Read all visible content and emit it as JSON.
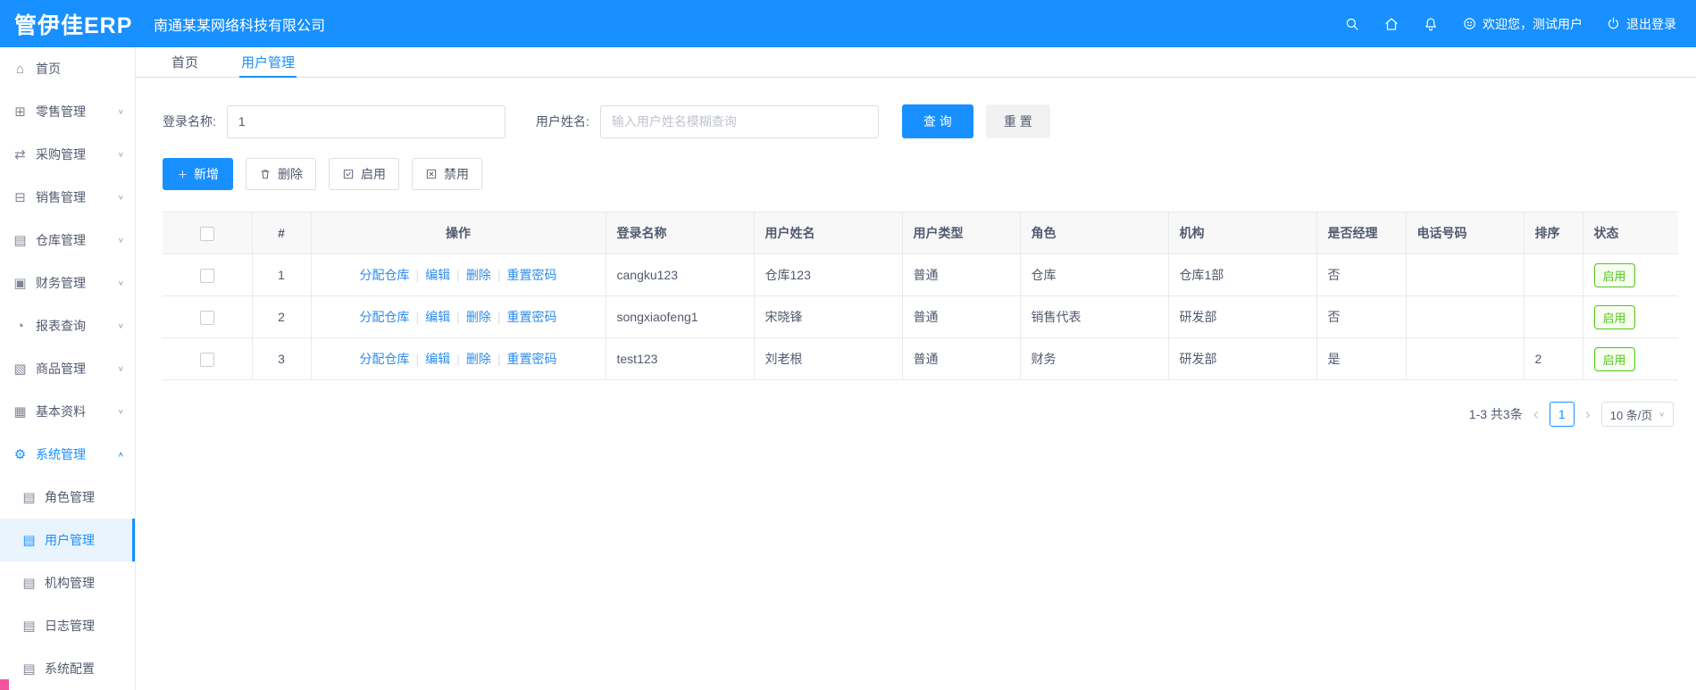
{
  "topbar": {
    "logo": "管伊佳ERP",
    "company": "南通某某网络科技有限公司",
    "welcome": "欢迎您，测试用户",
    "logout": "退出登录"
  },
  "sidebar": {
    "items": [
      {
        "label": "首页"
      },
      {
        "label": "零售管理"
      },
      {
        "label": "采购管理"
      },
      {
        "label": "销售管理"
      },
      {
        "label": "仓库管理"
      },
      {
        "label": "财务管理"
      },
      {
        "label": "报表查询"
      },
      {
        "label": "商品管理"
      },
      {
        "label": "基本资料"
      },
      {
        "label": "系统管理"
      }
    ],
    "system_children": [
      {
        "label": "角色管理"
      },
      {
        "label": "用户管理"
      },
      {
        "label": "机构管理"
      },
      {
        "label": "日志管理"
      },
      {
        "label": "系统配置"
      }
    ]
  },
  "tabs": {
    "home": "首页",
    "current": "用户管理"
  },
  "filter": {
    "login_label": "登录名称:",
    "login_value": "1",
    "name_label": "用户姓名:",
    "name_placeholder": "输入用户姓名模糊查询",
    "search_label": "查 询",
    "reset_label": "重 置"
  },
  "toolbar": {
    "add": "新增",
    "delete": "删除",
    "enable": "启用",
    "disable": "禁用"
  },
  "table": {
    "headers": [
      "#",
      "操作",
      "登录名称",
      "用户姓名",
      "用户类型",
      "角色",
      "机构",
      "是否经理",
      "电话号码",
      "排序",
      "状态"
    ],
    "ops": [
      "分配仓库",
      "编辑",
      "删除",
      "重置密码"
    ],
    "rows": [
      {
        "num": "1",
        "login": "cangku123",
        "name": "仓库123",
        "type": "普通",
        "role": "仓库",
        "org": "仓库1部",
        "manager": "否",
        "phone": "",
        "sort": "",
        "status": "启用"
      },
      {
        "num": "2",
        "login": "songxiaofeng1",
        "name": "宋晓锋",
        "type": "普通",
        "role": "销售代表",
        "org": "研发部",
        "manager": "否",
        "phone": "",
        "sort": "",
        "status": "启用"
      },
      {
        "num": "3",
        "login": "test123",
        "name": "刘老根",
        "type": "普通",
        "role": "财务",
        "org": "研发部",
        "manager": "是",
        "phone": "",
        "sort": "2",
        "status": "启用"
      }
    ]
  },
  "pagination": {
    "total": "1-3 共3条",
    "current_page": "1",
    "page_size": "10 条/页"
  }
}
